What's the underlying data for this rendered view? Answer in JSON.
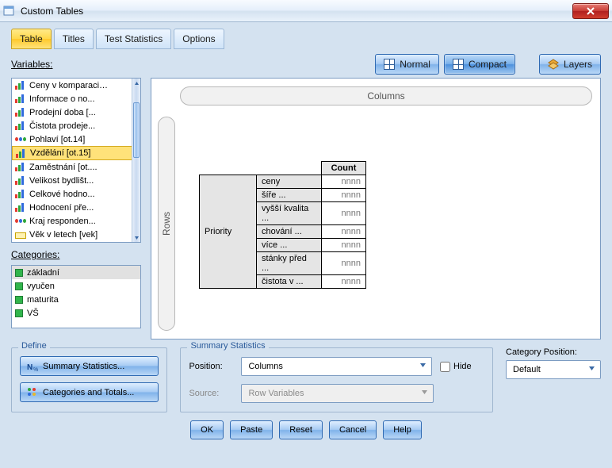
{
  "window": {
    "title": "Custom Tables"
  },
  "tabs": [
    {
      "label": "Table"
    },
    {
      "label": "Titles"
    },
    {
      "label": "Test Statistics"
    },
    {
      "label": "Options"
    }
  ],
  "viewbar": {
    "normal": "Normal",
    "compact": "Compact",
    "layers": "Layers"
  },
  "variables": {
    "label": "Variables:",
    "items": [
      {
        "label": "Ceny v komparaci…",
        "icon": "bars"
      },
      {
        "label": "Informace o no...",
        "icon": "bars"
      },
      {
        "label": "Prodejní doba [...",
        "icon": "bars"
      },
      {
        "label": "Čistota prodeje...",
        "icon": "bars"
      },
      {
        "label": "Pohlaví [ot.14]",
        "icon": "circles"
      },
      {
        "label": "Vzdělání [ot.15]",
        "icon": "bars"
      },
      {
        "label": "Zaměstnání [ot....",
        "icon": "bars"
      },
      {
        "label": "Velikost bydlišt...",
        "icon": "bars"
      },
      {
        "label": "Celkové hodno...",
        "icon": "bars"
      },
      {
        "label": "Hodnocení pře...",
        "icon": "bars"
      },
      {
        "label": "Kraj responden...",
        "icon": "circles"
      },
      {
        "label": "Věk v letech [vek]",
        "icon": "ruler"
      }
    ],
    "selected_index": 5
  },
  "categories": {
    "label": "Categories:",
    "items": [
      "základní",
      "vyučen",
      "maturita",
      "VŠ"
    ],
    "selected_index": 0
  },
  "canvas": {
    "columns_label": "Columns",
    "rows_label": "Rows",
    "header_stat": "Count",
    "row_variable": "Priority",
    "rows": [
      {
        "label": "ceny",
        "value": "nnnn"
      },
      {
        "label": "šíře ...",
        "value": "nnnn"
      },
      {
        "label": "vyšší kvalita ...",
        "value": "nnnn"
      },
      {
        "label": "chování ...",
        "value": "nnnn"
      },
      {
        "label": "více ...",
        "value": "nnnn"
      },
      {
        "label": "stánky před ...",
        "value": "nnnn"
      },
      {
        "label": "čistota v ...",
        "value": "nnnn"
      }
    ]
  },
  "define": {
    "legend": "Define",
    "summary_btn": "Summary Statistics...",
    "categories_btn": "Categories and Totals..."
  },
  "summary": {
    "legend": "Summary Statistics",
    "position_label": "Position:",
    "position_value": "Columns",
    "hide_label": "Hide",
    "source_label": "Source:",
    "source_value": "Row Variables"
  },
  "catpos": {
    "label": "Category Position:",
    "value": "Default"
  },
  "actions": {
    "ok": "OK",
    "paste": "Paste",
    "reset": "Reset",
    "cancel": "Cancel",
    "help": "Help"
  }
}
